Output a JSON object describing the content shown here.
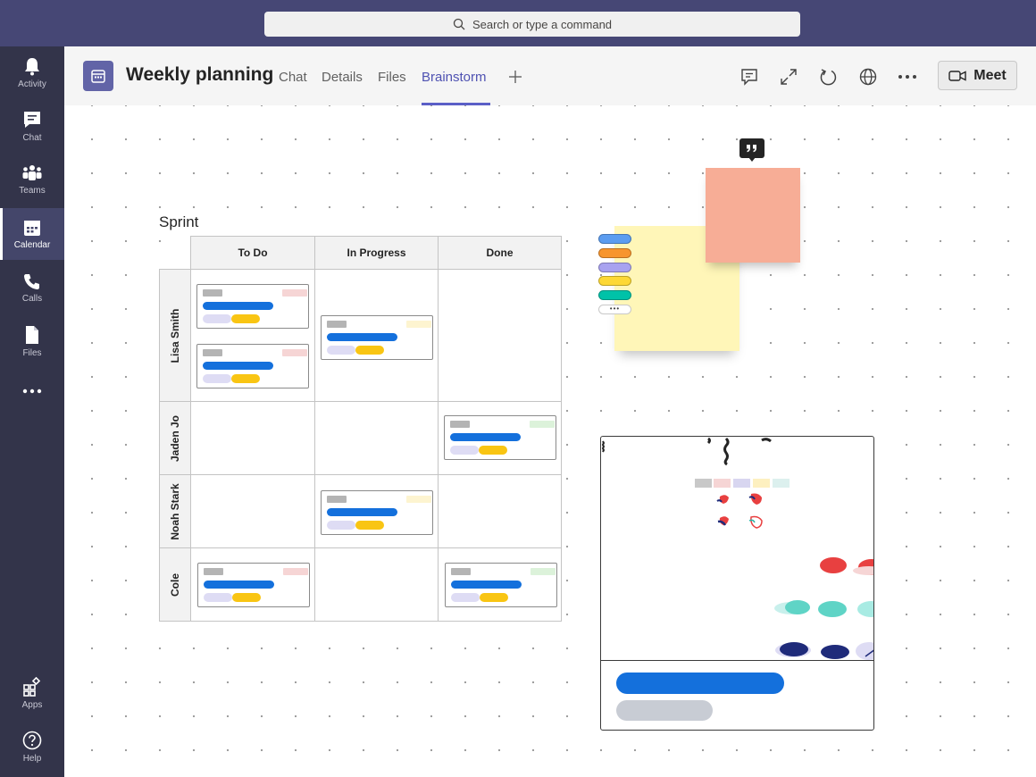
{
  "search": {
    "placeholder": "Search or type a command"
  },
  "rail": {
    "items": [
      {
        "label": "Activity",
        "icon": "bell-icon"
      },
      {
        "label": "Chat",
        "icon": "chat-icon"
      },
      {
        "label": "Teams",
        "icon": "teams-icon"
      },
      {
        "label": "Calendar",
        "icon": "calendar-icon",
        "active": true
      },
      {
        "label": "Calls",
        "icon": "phone-icon"
      },
      {
        "label": "Files",
        "icon": "file-icon"
      }
    ],
    "bottom": [
      {
        "label": "Apps",
        "icon": "apps-icon"
      },
      {
        "label": "Help",
        "icon": "help-icon"
      }
    ]
  },
  "header": {
    "title": "Weekly planning",
    "tabs": [
      "Chat",
      "Details",
      "Files",
      "Brainstorm"
    ],
    "active_tab": "Brainstorm",
    "meet_label": "Meet"
  },
  "board": {
    "title": "Sprint",
    "columns": [
      "To Do",
      "In Progress",
      "Done"
    ],
    "rows": [
      "Lisa Smith",
      "Jaden Jo",
      "Noah Stark",
      "Cole"
    ]
  },
  "sticky": {
    "more_label": "•••",
    "colors": [
      "#5b9cf0",
      "#f7952e",
      "#a8a2f0",
      "#fdd835",
      "#00c2a8"
    ]
  },
  "colors": {
    "accent": "#6264a7",
    "titlebar": "#464775",
    "rail": "#33344a",
    "card_bar": "#1470dc",
    "card_tag": "#f9c513"
  }
}
